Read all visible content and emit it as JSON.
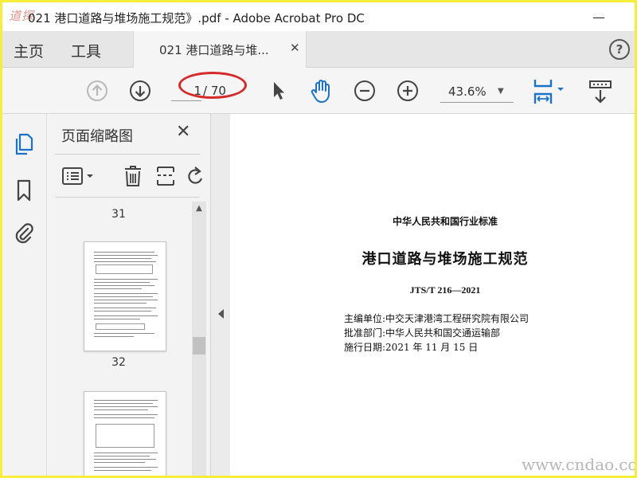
{
  "window": {
    "title": "021 港口道路与堆场施工规范》.pdf - Adobe Acrobat Pro DC",
    "logo_text": "道探",
    "minimize_glyph": "—",
    "close_glyph": "✕"
  },
  "nav": {
    "home_label": "主页",
    "tools_label": "工具",
    "doc_tab_label": "021 港口道路与堆...",
    "doc_tab_close": "✕",
    "help_glyph": "?"
  },
  "toolbar": {
    "current_page": "1",
    "total_pages": "/ 70",
    "zoom": "43.6%",
    "zoom_caret": "▼",
    "icons": [
      "prev-page-icon",
      "next-page-icon",
      "select-cursor-icon",
      "hand-tool-icon",
      "zoom-out-icon",
      "zoom-in-icon",
      "page-fit-icon",
      "scroll-mode-icon"
    ],
    "accent_color": "#1a73c8"
  },
  "rail": {
    "icons": [
      "page-thumbnails-icon",
      "bookmarks-icon",
      "attachments-icon"
    ]
  },
  "thumbnails": {
    "title": "页面缩略图",
    "close_glyph": "✕",
    "items": [
      {
        "label": "31"
      },
      {
        "label": "32"
      }
    ],
    "scroll_up_glyph": "▲"
  },
  "document": {
    "org": "中华人民共和国行业标准",
    "title": "港口道路与堆场施工规范",
    "code": "JTS/T 216—2021",
    "editor": "主编单位:中交天津港湾工程研究院有限公司",
    "approver": "批准部门:中华人民共和国交通运输部",
    "effective": "施行日期:2021 年 11 月 15 日"
  },
  "watermark": "www.cndao.com"
}
